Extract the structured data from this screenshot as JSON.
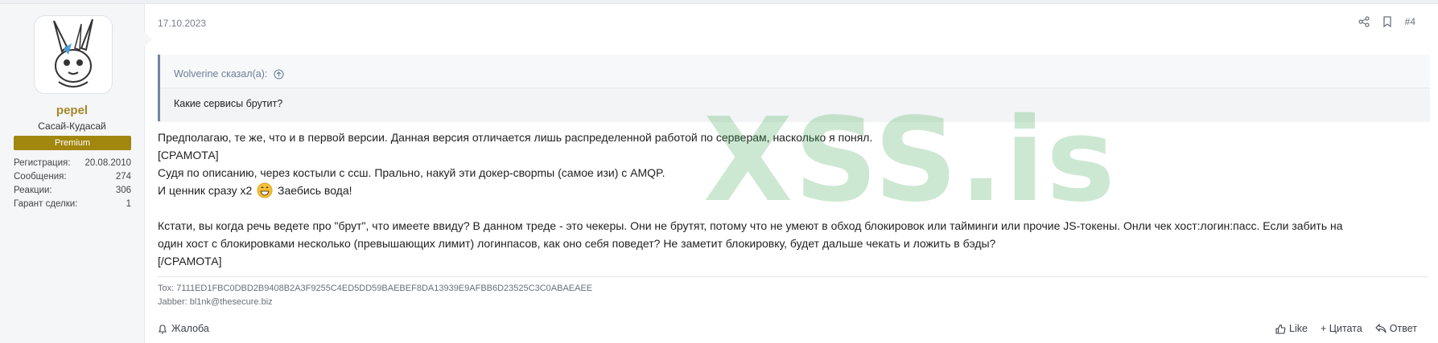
{
  "post": {
    "date": "17.10.2023",
    "number": "#4",
    "user": {
      "name": "pepel",
      "title": "Сасай-Кудасай",
      "badge": "Premium",
      "stats": [
        {
          "label": "Регистрация:",
          "value": "20.08.2010"
        },
        {
          "label": "Сообщения:",
          "value": "274"
        },
        {
          "label": "Реакции:",
          "value": "306"
        },
        {
          "label": "Гарант сделки:",
          "value": "1"
        }
      ]
    },
    "quote": {
      "author": "Wolverine сказал(а):",
      "text": "Какие сервисы брутит?"
    },
    "body": {
      "l1": "Предполагаю, те же, что и в первой версии. Данная версия отличается лишь распределенной работой по серверам, насколько я понял.",
      "l2": "[СРАМОТА]",
      "l3": "Судя по описанию, через костыли с ссш. Прально, накуй эти докер-сворmы (самое изи) с AMQP.",
      "l4a": "И ценник сразу х2",
      "l4b": "Заебись вода!",
      "l5": "Кстати, вы когда речь ведете про \"брут\", что имеете ввиду? В данном треде - это чекеры. Они не брутят, потому что не умеют в обход блокировок или тайминги или прочие JS-токены. Онли чек хост:логин:пасс. Если забить на",
      "l6": "один хост с блокировками несколько (превышающих лимит) логинпасов, как оно себя поведет? Не заметит блокировку, будет дальше чекать и ложить в бэды?",
      "l7": "[/СРАМОТА]"
    },
    "signature": {
      "tox": "Tox: 7111ED1FBC0DBD2B9408B2A3F9255C4ED5DD59BAEBEF8DA13939E9AFBB6D23525C3C0ABAEAEE",
      "jabber": "Jabber: bl1nk@thesecure.biz"
    },
    "actions": {
      "report": "Жалоба",
      "like": "Like",
      "quote": "+ Цитата",
      "reply": "Ответ"
    },
    "watermark": "XSS.is"
  },
  "colors": {
    "accent": "#a2872a",
    "badge_bg": "#a2870f",
    "quote_border": "#6f86a7",
    "watermark": "#46aa5a"
  }
}
